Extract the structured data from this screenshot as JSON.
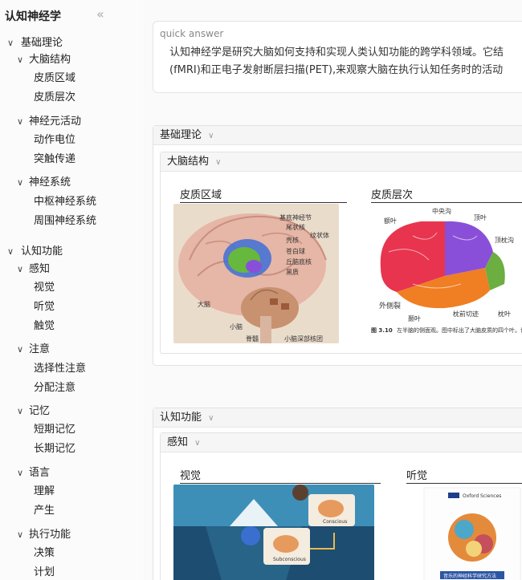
{
  "sidebar": {
    "title": "认知神经学",
    "collapse_icon": "double-chevron-left-icon",
    "items": [
      {
        "label": "基础理论"
      },
      {
        "label": "大脑结构"
      },
      {
        "label": "皮质区域"
      },
      {
        "label": "皮质层次"
      },
      {
        "label": "神经元活动"
      },
      {
        "label": "动作电位"
      },
      {
        "label": "突触传递"
      },
      {
        "label": "神经系统"
      },
      {
        "label": "中枢神经系统"
      },
      {
        "label": "周围神经系统"
      },
      {
        "label": "认知功能"
      },
      {
        "label": "感知"
      },
      {
        "label": "视觉"
      },
      {
        "label": "听觉"
      },
      {
        "label": "触觉"
      },
      {
        "label": "注意"
      },
      {
        "label": "选择性注意"
      },
      {
        "label": "分配注意"
      },
      {
        "label": "记忆"
      },
      {
        "label": "短期记忆"
      },
      {
        "label": "长期记忆"
      },
      {
        "label": "语言"
      },
      {
        "label": "理解"
      },
      {
        "label": "产生"
      },
      {
        "label": "执行功能"
      },
      {
        "label": "决策"
      },
      {
        "label": "计划"
      }
    ]
  },
  "quick_answer": {
    "label": "quick answer",
    "line1": "认知神经学是研究大脑如何支持和实现人类认知功能的跨学科领域。它结",
    "line2": "(fMRI)和正电子发射断层扫描(PET),来观察大脑在执行认知任务时的活动"
  },
  "sections": [
    {
      "title": "基础理论",
      "sub": {
        "title": "大脑结构",
        "cards": [
          {
            "title": "皮质区域",
            "labels": [
              "基底神经节",
              "尾状核",
              "纹状体",
              "壳核",
              "苍白球",
              "丘脑底核",
              "黑质",
              "大脑",
              "小脑",
              "脊髓",
              "小脑深部核团"
            ]
          },
          {
            "title": "皮质层次",
            "labels": [
              "中央沟",
              "额叶",
              "顶叶",
              "顶枕沟",
              "颞叶",
              "枕前切迹",
              "枕叶",
              "外侧裂"
            ],
            "caption_bold": "图 3.10",
            "caption": "左半脑的侧面观。图中标出了大脑皮质的四个叶。详细介绍见正文。"
          }
        ]
      }
    },
    {
      "title": "认知功能",
      "sub": {
        "title": "感知",
        "cards": [
          {
            "title": "视觉",
            "labels": [
              "Conscious",
              "Subconscious"
            ]
          },
          {
            "title": "听觉",
            "labels": [
              "Oxford",
              "Sciences",
              "音乐的神经科学研究方法"
            ]
          }
        ]
      }
    }
  ],
  "colors": {
    "frontal": "#e8344e",
    "parietal": "#8a4fd8",
    "temporal": "#f07e22",
    "occipital": "#6cae3f",
    "basal_ganglia": "#3d6fd6"
  }
}
